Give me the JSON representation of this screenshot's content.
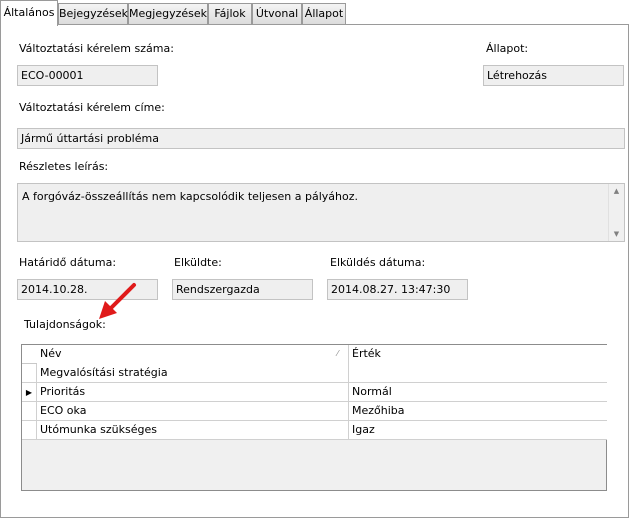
{
  "tabs": [
    "Általános",
    "Bejegyzések",
    "Megjegyzések",
    "Fájlok",
    "Útvonal",
    "Állapot"
  ],
  "fields": {
    "eco_number_label": "Változtatási kérelem száma:",
    "eco_number_value": "ECO-00001",
    "status_label": "Állapot:",
    "status_value": "Létrehozás",
    "title_label": "Változtatási kérelem címe:",
    "title_value": "Jármű úttartási probléma",
    "description_label": "Részletes leírás:",
    "description_value": "A forgóváz-összeállítás nem kapcsolódik teljesen a pályához.",
    "deadline_label": "Határidő dátuma:",
    "deadline_value": "2014.10.28.",
    "sender_label": "Elküldte:",
    "sender_value": "Rendszergazda",
    "sent_date_label": "Elküldés dátuma:",
    "sent_date_value": "2014.08.27. 13:47:30"
  },
  "properties": {
    "label": "Tulajdonságok:",
    "columns": [
      "Név",
      "Érték"
    ],
    "rows": [
      {
        "name": "Megvalósítási stratégia",
        "value": ""
      },
      {
        "name": "Prioritás",
        "value": "Normál",
        "selector": "▶"
      },
      {
        "name": "ECO oka",
        "value": "Mezőhiba"
      },
      {
        "name": "Utómunka szükséges",
        "value": "Igaz"
      }
    ]
  },
  "colors": {
    "annotation_arrow": "#e01a1a"
  }
}
